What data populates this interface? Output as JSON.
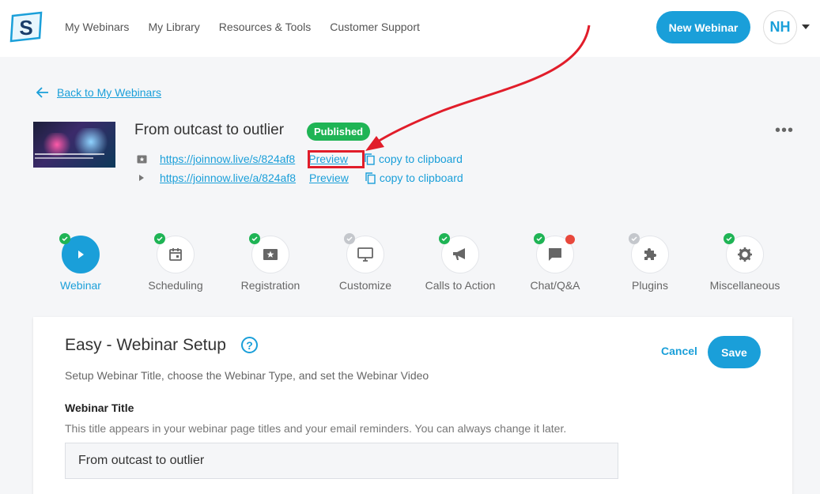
{
  "nav": {
    "items": [
      "My Webinars",
      "My Library",
      "Resources & Tools",
      "Customer Support"
    ],
    "new_webinar": "New Webinar",
    "avatar_initials": "NH"
  },
  "back_link": "Back to My Webinars",
  "webinar": {
    "title": "From outcast to outlier",
    "status": "Published",
    "links": [
      {
        "icon": "ticket-icon",
        "url": "https://joinnow.live/s/824af8",
        "preview": "Preview",
        "copy": "copy to clipboard"
      },
      {
        "icon": "play-icon",
        "url": "https://joinnow.live/a/824af8",
        "preview": "Preview",
        "copy": "copy to clipboard"
      }
    ]
  },
  "steps": [
    {
      "label": "Webinar",
      "icon": "play-icon",
      "check": "green",
      "active": true
    },
    {
      "label": "Scheduling",
      "icon": "calendar-icon",
      "check": "green"
    },
    {
      "label": "Registration",
      "icon": "ticket-star-icon",
      "check": "green"
    },
    {
      "label": "Customize",
      "icon": "monitor-icon",
      "check": "grey"
    },
    {
      "label": "Calls to Action",
      "icon": "megaphone-icon",
      "check": "green"
    },
    {
      "label": "Chat/Q&A",
      "icon": "chat-icon",
      "check": "green",
      "notification": true
    },
    {
      "label": "Plugins",
      "icon": "puzzle-icon",
      "check": "grey"
    },
    {
      "label": "Miscellaneous",
      "icon": "gear-icon",
      "check": "green"
    }
  ],
  "setup": {
    "title": "Easy - Webinar Setup",
    "help": "?",
    "subtitle": "Setup Webinar Title, choose the Webinar Type, and set the Webinar Video",
    "cancel": "Cancel",
    "save": "Save",
    "field_label": "Webinar Title",
    "field_help": "This title appears in your webinar page titles and your email reminders. You can always change it later.",
    "field_value": "From outcast to outlier"
  },
  "colors": {
    "accent": "#1a9fd9",
    "published": "#1fb455",
    "highlight": "#e11d2a"
  }
}
